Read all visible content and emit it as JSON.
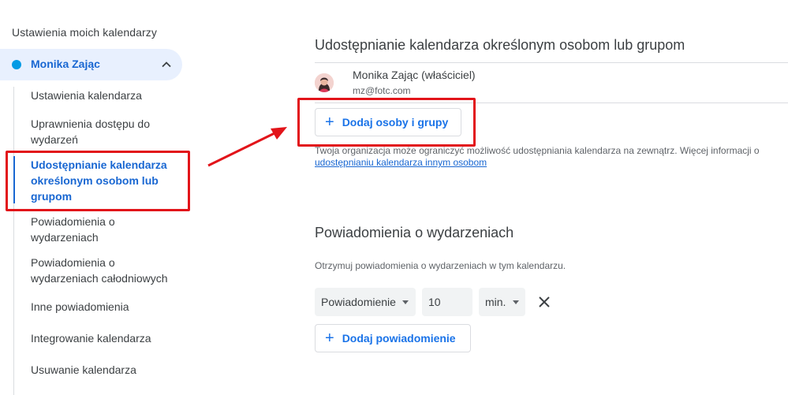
{
  "sidebar": {
    "title": "Ustawienia moich kalendarzy",
    "calendar": {
      "name": "Monika Zając",
      "color": "#039be5"
    },
    "items": [
      {
        "label": "Ustawienia kalendarza"
      },
      {
        "label": "Uprawnienia dostępu do wydarzeń"
      },
      {
        "label": "Udostępnianie kalendarza określonym osobom lub grupom",
        "active": true
      },
      {
        "label": "Powiadomienia o wydarzeniach"
      },
      {
        "label": "Powiadomienia o wydarzeniach całodniowych"
      },
      {
        "label": "Inne powiadomienia"
      },
      {
        "label": "Integrowanie kalendarza"
      },
      {
        "label": "Usuwanie kalendarza"
      }
    ]
  },
  "sharing": {
    "heading": "Udostępnianie kalendarza określonym osobom lub grupom",
    "owner_name": "Monika Zając (właściciel)",
    "owner_email": "mz@fotc.com",
    "add_button": "Dodaj osoby i grupy",
    "info_text": "Twoja organizacja może ograniczyć możliwość udostępniania kalendarza na zewnątrz. Więcej informacji o",
    "info_link": "udostępnianiu kalendarza innym osobom"
  },
  "notifications": {
    "heading": "Powiadomienia o wydarzeniach",
    "description": "Otrzymuj powiadomienia o wydarzeniach w tym kalendarzu.",
    "type_value": "Powiadomienie",
    "amount_value": "10",
    "unit_value": "min.",
    "add_button": "Dodaj powiadomienie"
  },
  "colors": {
    "accent": "#1a73e8",
    "annotation": "#e2141a"
  }
}
